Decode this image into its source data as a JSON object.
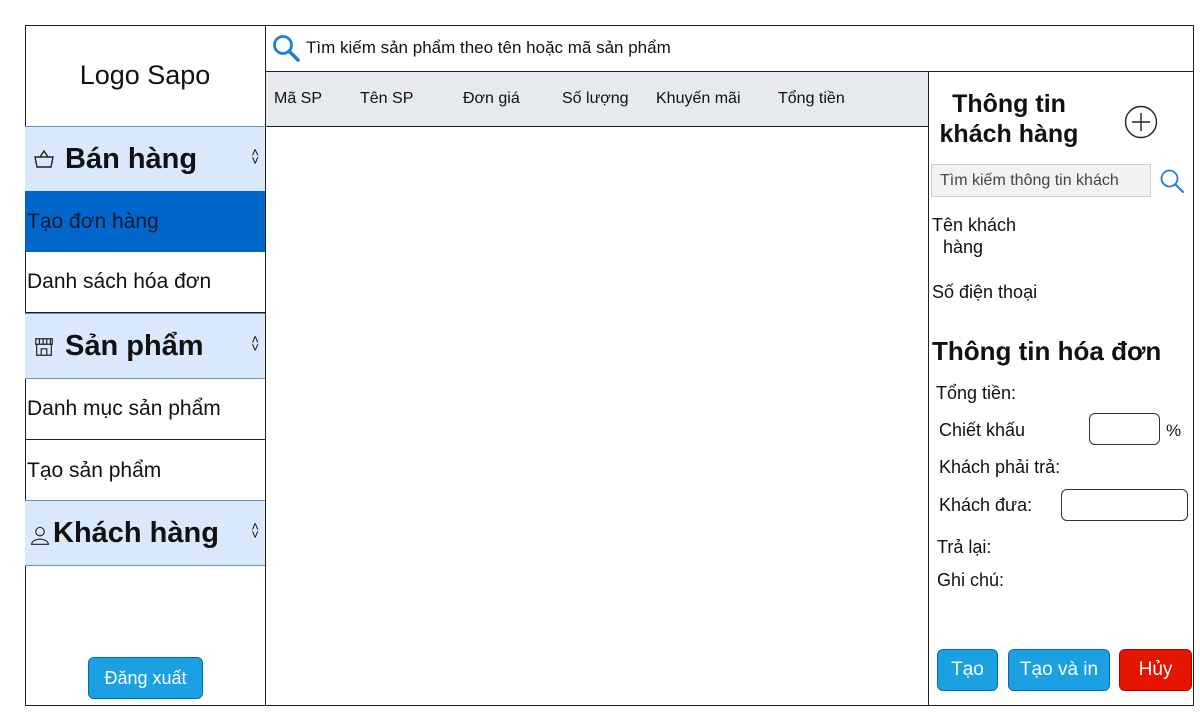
{
  "sidebar": {
    "logo": "Logo Sapo",
    "sections": {
      "sales": {
        "label": "Bán hàng",
        "icon": "shopping-basket-icon"
      },
      "products": {
        "label": "Sản phẩm",
        "icon": "store-icon"
      },
      "customers": {
        "label": "Khách hàng",
        "icon": "user-icon"
      }
    },
    "items": {
      "create_order": "Tạo đơn hàng",
      "invoice_list": "Danh sách hóa đơn",
      "product_catalog": "Danh mục sản phẩm",
      "create_product": "Tạo sản phẩm"
    },
    "logout_label": "Đăng xuất"
  },
  "search": {
    "placeholder": "Tìm kiếm sản phẩm theo tên hoặc mã sản phẩm"
  },
  "table": {
    "columns": [
      "Mã SP",
      "Tên SP",
      "Đơn giá",
      "Số lượng",
      "Khuyến mãi",
      "Tổng tiền"
    ]
  },
  "customer": {
    "title_line1": "Thông tin",
    "title_line2": "khách hàng",
    "search_placeholder": "Tìm kiếm thông tin khách",
    "name_label_line1": "Tên khách",
    "name_label_line2": "hàng",
    "phone_label": "Số điện thoại"
  },
  "invoice": {
    "title": "Thông tin hóa đơn",
    "total_label": "Tổng tiền:",
    "discount_label": "Chiết khấu",
    "discount_unit": "%",
    "payable_label": "Khách phải trả:",
    "paid_label": "Khách đưa:",
    "change_label": "Trả lại:",
    "note_label": "Ghi chú:"
  },
  "actions": {
    "create": "Tạo",
    "create_print": "Tạo và in",
    "cancel": "Hủy"
  },
  "colors": {
    "section_bg": "#dae8fc",
    "active_item": "#0066cc",
    "primary_button": "#1ba1e2",
    "danger_button": "#e51400",
    "table_header": "#e6e9ee"
  }
}
